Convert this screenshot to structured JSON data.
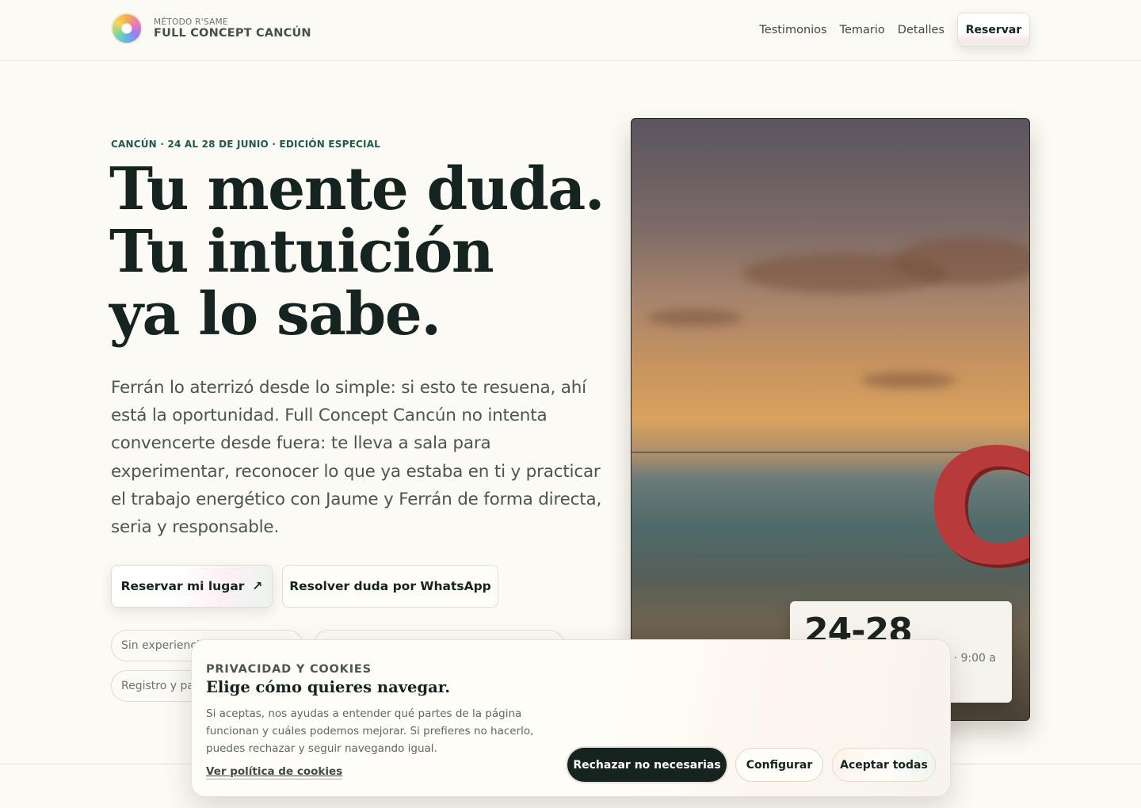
{
  "header": {
    "brand_sub": "MÉTODO R'SAME",
    "brand_name": "FULL CONCEPT CANCÚN",
    "nav": [
      "Testimonios",
      "Temario",
      "Detalles"
    ],
    "cta": "Reservar"
  },
  "hero": {
    "eyebrow": "CANCÚN · 24 AL 28 DE JUNIO · EDICIÓN ESPECIAL",
    "headline": [
      "Tu mente duda.",
      "Tu intuición",
      "ya lo sabe."
    ],
    "lead": "Ferrán lo aterrizó desde lo simple: si esto te resuena, ahí está la oportunidad. Full Concept Cancún no intenta convencerte desde fuera: te lleva a sala para experimentar, reconocer lo que ya estaba en ti y practicar el trabajo energético con Jaume y Ferrán de forma directa, seria y responsable.",
    "cta_primary": "Reservar mi lugar",
    "cta_primary_icon": "↗",
    "cta_secondary": "Resolver duda por WhatsApp",
    "chips": [
      "Sin experienci",
      "Registro y pa"
    ]
  },
  "photo": {
    "sign_text": "CA",
    "date_card": {
      "dates": "24-28",
      "detail": "o · 9:00 a"
    }
  },
  "cookie": {
    "eyebrow": "PRIVACIDAD Y COOKIES",
    "title": "Elige cómo quieres navegar.",
    "body": "Si aceptas, nos ayudas a entender qué partes de la página funcionan y cuáles podemos mejorar. Si prefieres no hacerlo, puedes rechazar y seguir navegando igual.",
    "link": "Ver política de cookies",
    "buttons": {
      "reject": "Rechazar no necesarias",
      "configure": "Configurar",
      "accept": "Aceptar todas"
    }
  }
}
